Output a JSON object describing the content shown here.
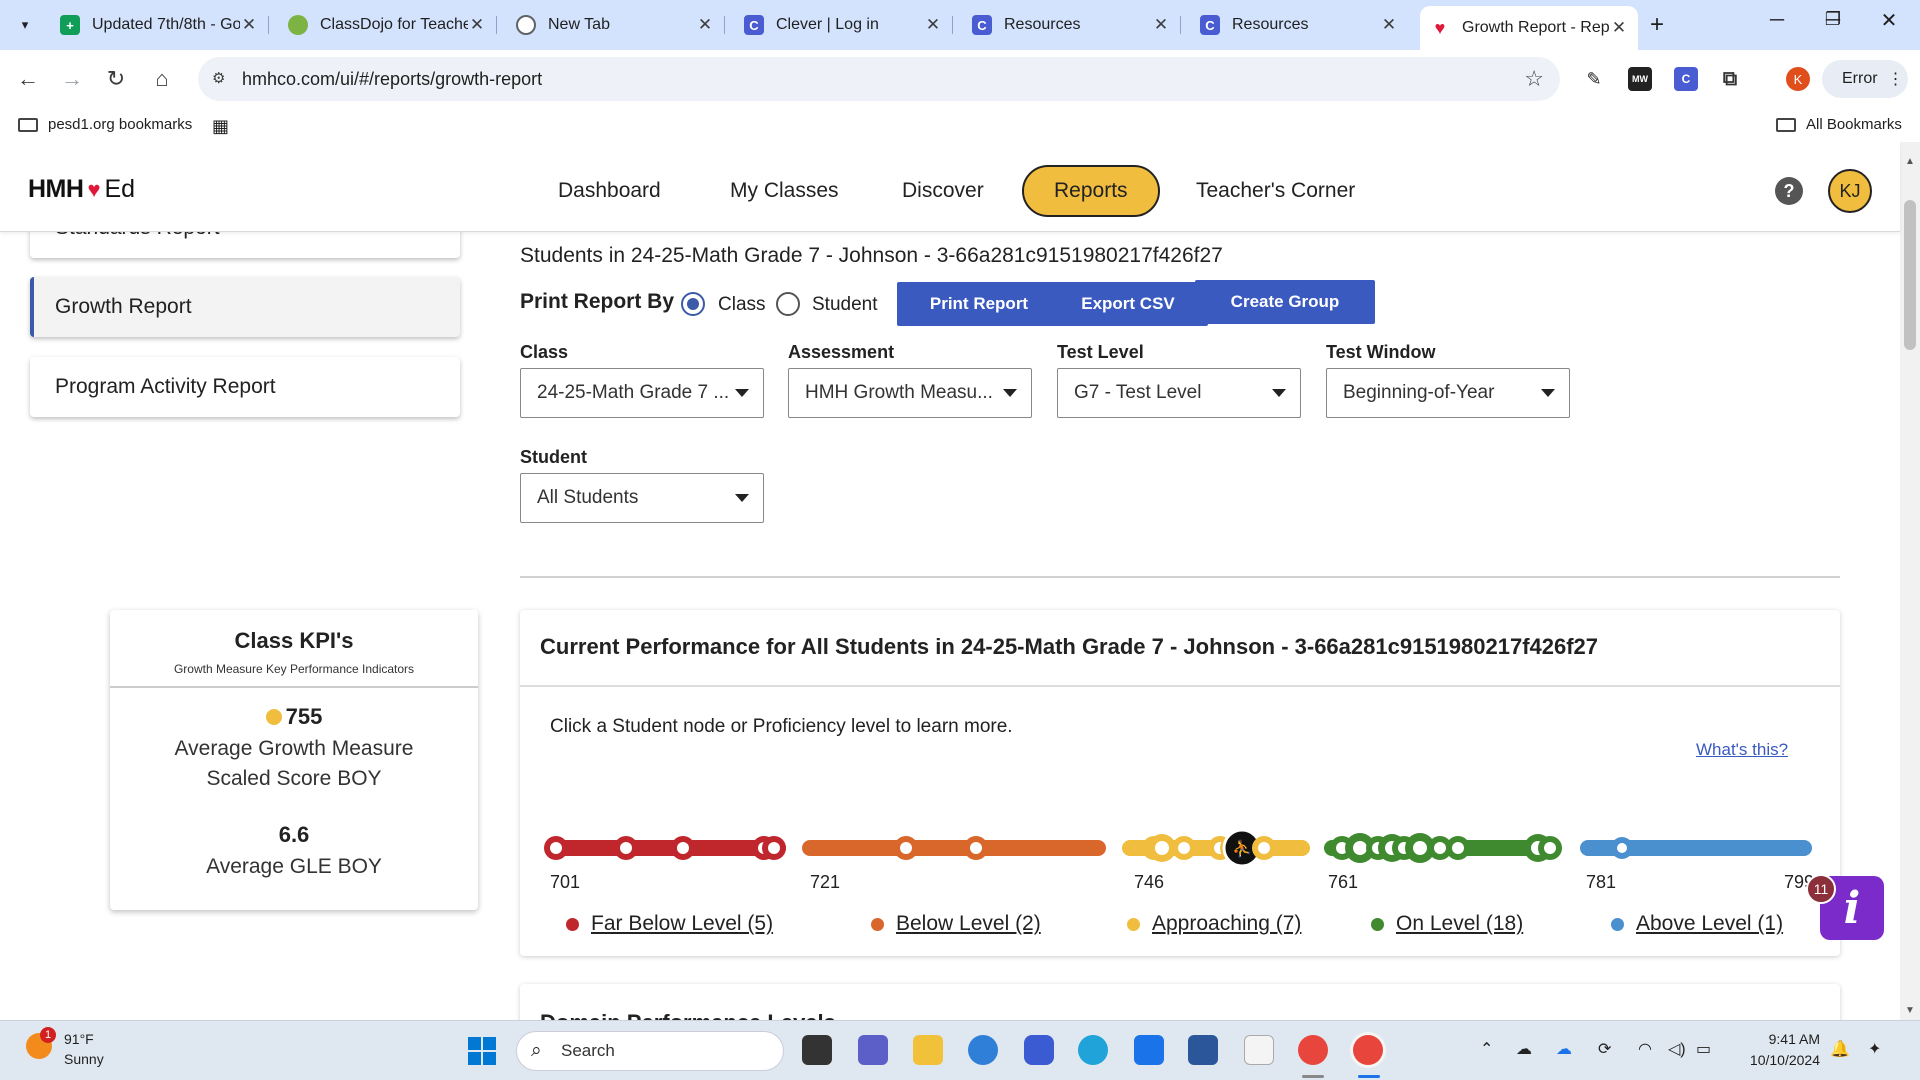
{
  "browser": {
    "tabs": [
      {
        "title": "Updated 7th/8th - Go",
        "icon": "sheets-icon",
        "color": "#0f9d58"
      },
      {
        "title": "ClassDojo for Teacher",
        "icon": "classdojo-icon",
        "color": "#2e7d32"
      },
      {
        "title": "New Tab",
        "icon": "chrome-icon",
        "color": "#5f6368"
      },
      {
        "title": "Clever | Log in",
        "icon": "clever-icon",
        "color": "#4a5cd1"
      },
      {
        "title": "Resources",
        "icon": "clever-icon",
        "color": "#4a5cd1"
      },
      {
        "title": "Resources",
        "icon": "clever-icon",
        "color": "#4a5cd1"
      },
      {
        "title": "Growth Report - Rep",
        "icon": "hmh-icon",
        "color": "#e0183a"
      }
    ],
    "url": "hmhco.com/ui/#/reports/growth-report",
    "profile_initial": "K",
    "error_label": "Error",
    "bookmarks": {
      "folder": "pesd1.org bookmarks",
      "all": "All Bookmarks"
    }
  },
  "app": {
    "logo_left": "HMH",
    "logo_right": "Ed",
    "nav": [
      "Dashboard",
      "My Classes",
      "Discover",
      "Reports",
      "Teacher's Corner"
    ],
    "active_nav": "Reports",
    "avatar": "KJ",
    "help": "?"
  },
  "sidebar": {
    "items": [
      {
        "label": "Standards Report",
        "active": false
      },
      {
        "label": "Growth Report",
        "active": true
      },
      {
        "label": "Program Activity Report",
        "active": false
      }
    ]
  },
  "report": {
    "subtitle": "Students in 24-25-Math Grade 7 - Johnson - 3-66a281c9151980217f426f27",
    "print_by_label": "Print Report By",
    "print_options": [
      "Class",
      "Student"
    ],
    "print_selected": "Class",
    "buttons": {
      "print": "Print Report",
      "export": "Export CSV",
      "group": "Create Group"
    },
    "filters": {
      "class": {
        "label": "Class",
        "value": "24-25-Math Grade 7 ..."
      },
      "assessment": {
        "label": "Assessment",
        "value": "HMH Growth Measu..."
      },
      "test_level": {
        "label": "Test Level",
        "value": "G7 - Test Level"
      },
      "test_window": {
        "label": "Test Window",
        "value": "Beginning-of-Year"
      },
      "student": {
        "label": "Student",
        "value": "All Students"
      }
    }
  },
  "kpi": {
    "title": "Class KPI's",
    "subtitle": "Growth Measure Key Performance Indicators",
    "score_value": "755",
    "score_desc": "Average Growth Measure Scaled Score BOY",
    "gle_value": "6.6",
    "gle_desc": "Average GLE BOY",
    "score_color": "#f0bd3f"
  },
  "performance": {
    "title": "Current Performance for All Students in 24-25-Math Grade 7 - Johnson - 3-66a281c9151980217f426f27",
    "instructions": "Click a Student node or Proficiency level to learn more.",
    "whats_this": "What's this?",
    "levels": [
      {
        "name": "Far Below Level (5)",
        "color": "#c0272d",
        "start": 701,
        "end": 721
      },
      {
        "name": "Below Level (2)",
        "color": "#d9662a",
        "start": 721,
        "end": 746
      },
      {
        "name": "Approaching (7)",
        "color": "#f0bd3f",
        "start": 746,
        "end": 761
      },
      {
        "name": "On Level (18)",
        "color": "#3f8a2e",
        "start": 761,
        "end": 781
      },
      {
        "name": "Above Level (1)",
        "color": "#4a90cf",
        "start": 781,
        "end": 799
      }
    ],
    "tick_labels": [
      "701",
      "721",
      "746",
      "761",
      "781",
      "799"
    ]
  },
  "domain": {
    "title": "Domain Performance Levels"
  },
  "chat": {
    "count": "11",
    "glyph": "i"
  },
  "taskbar": {
    "temp": "91°F",
    "condition": "Sunny",
    "weather_badge": "1",
    "search_placeholder": "Search",
    "time": "9:41 AM",
    "date": "10/10/2024"
  }
}
